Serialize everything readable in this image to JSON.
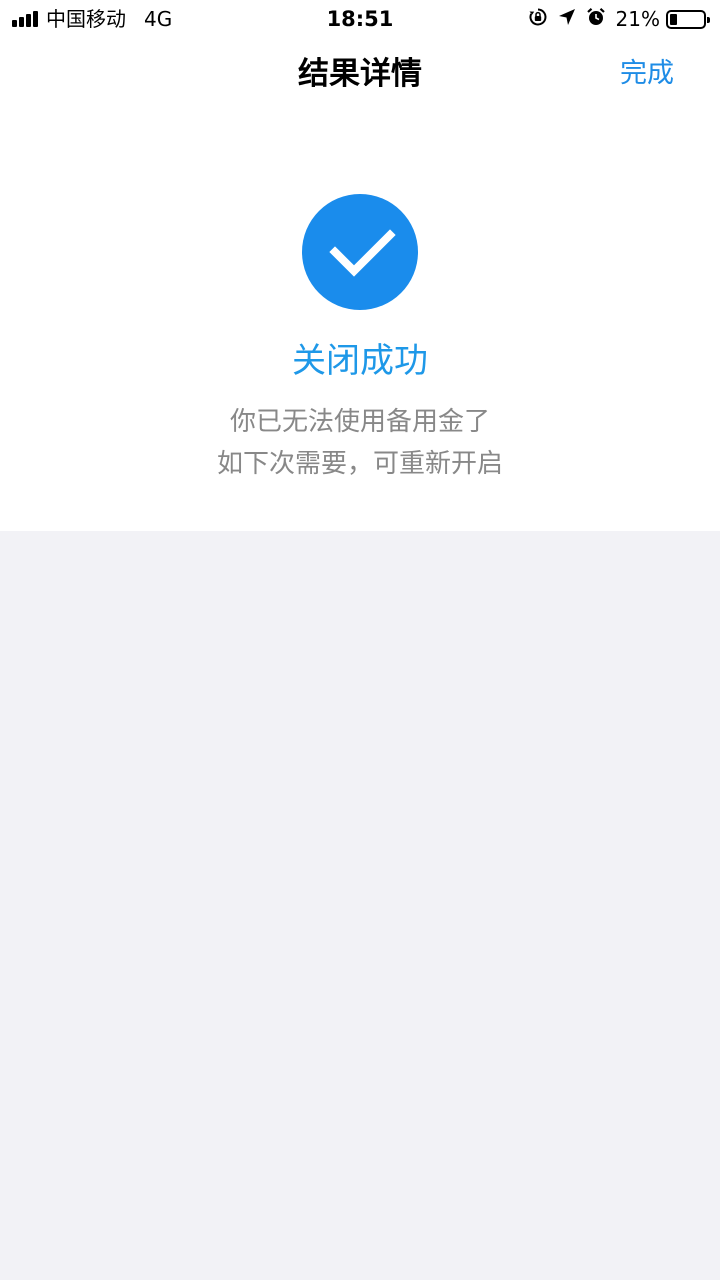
{
  "status_bar": {
    "carrier": "中国移动",
    "network": "4G",
    "time": "18:51",
    "battery_percent": "21%",
    "battery_level": 0.21,
    "icons": [
      "signal-icon",
      "rotation-lock-icon",
      "location-icon",
      "alarm-icon",
      "battery-icon"
    ]
  },
  "nav": {
    "title": "结果详情",
    "done_label": "完成"
  },
  "result": {
    "icon": "checkmark-circle-icon",
    "title": "关闭成功",
    "line1": "你已无法使用备用金了",
    "line2": "如下次需要，可重新开启"
  },
  "colors": {
    "accent": "#1a8cec",
    "title_blue": "#1e98e8",
    "secondary_text": "#888888",
    "background": "#f2f2f6"
  }
}
